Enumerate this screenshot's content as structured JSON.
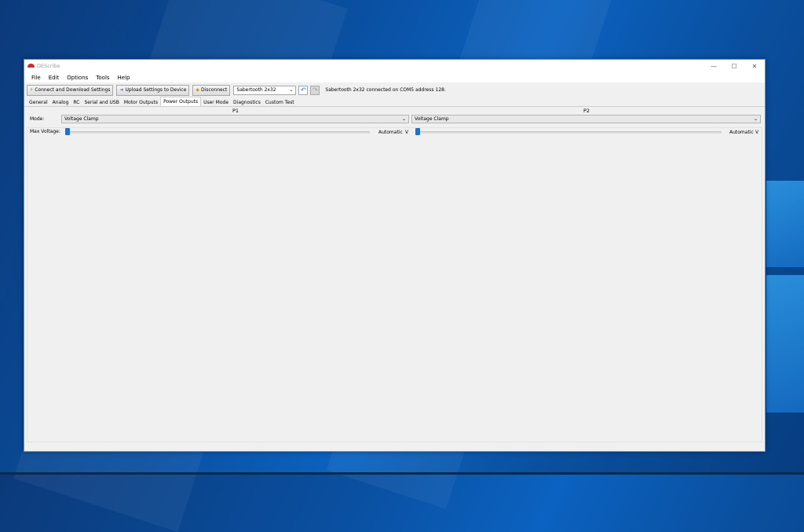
{
  "window": {
    "title": "DEScribe",
    "controls": {
      "minimize": "—",
      "maximize": "☐",
      "close": "✕"
    }
  },
  "menu": [
    "File",
    "Edit",
    "Options",
    "Tools",
    "Help"
  ],
  "toolbar": {
    "connect_label": "Connect and Download Settings",
    "upload_label": "Upload Settings to Device",
    "disconnect_label": "Disconnect",
    "device_selected": "Sabertooth 2x32",
    "status_text": "Sabertooth 2x32 connected on COM5 address 128."
  },
  "tabs": [
    "General",
    "Analog",
    "RC",
    "Serial and USB",
    "Motor Outputs",
    "Power Outputs",
    "User Mode",
    "Diagnostics",
    "Custom Test"
  ],
  "active_tab": "Power Outputs",
  "power_outputs": {
    "mode_label": "Mode:",
    "max_voltage_label": "Max Voltage:",
    "p1": {
      "header": "P1",
      "mode": "Voltage Clamp",
      "max_voltage_text": "Automatic",
      "unit": "V",
      "slider_fraction": 0
    },
    "p2": {
      "header": "P2",
      "mode": "Voltage Clamp",
      "max_voltage_text": "Automatic",
      "unit": "V",
      "slider_fraction": 0
    }
  },
  "colors": {
    "accent": "#1f6fd1",
    "window_bg": "#f0f0f0",
    "app_icon": "#d2282e"
  }
}
